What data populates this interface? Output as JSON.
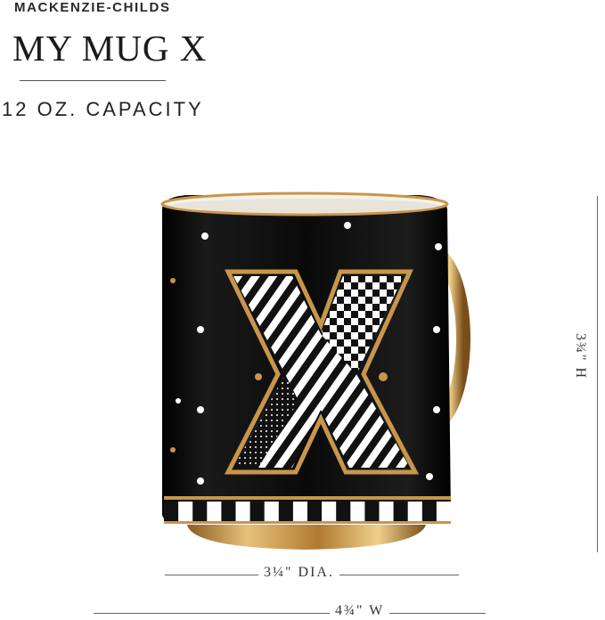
{
  "header": {
    "brand": "MACKENZIE-CHILDS",
    "title": "MY MUG X",
    "capacity": "12 OZ. CAPACITY"
  },
  "mug": {
    "letter": "X",
    "body_color": "#0d0d0d",
    "accent_color": "#c8964a",
    "image_alt": "black-and-gold-mug-illustration"
  },
  "dimensions": {
    "diameter": "3¼\" DIA.",
    "width": "4¾\"  W",
    "height": "3¾\"  H"
  }
}
